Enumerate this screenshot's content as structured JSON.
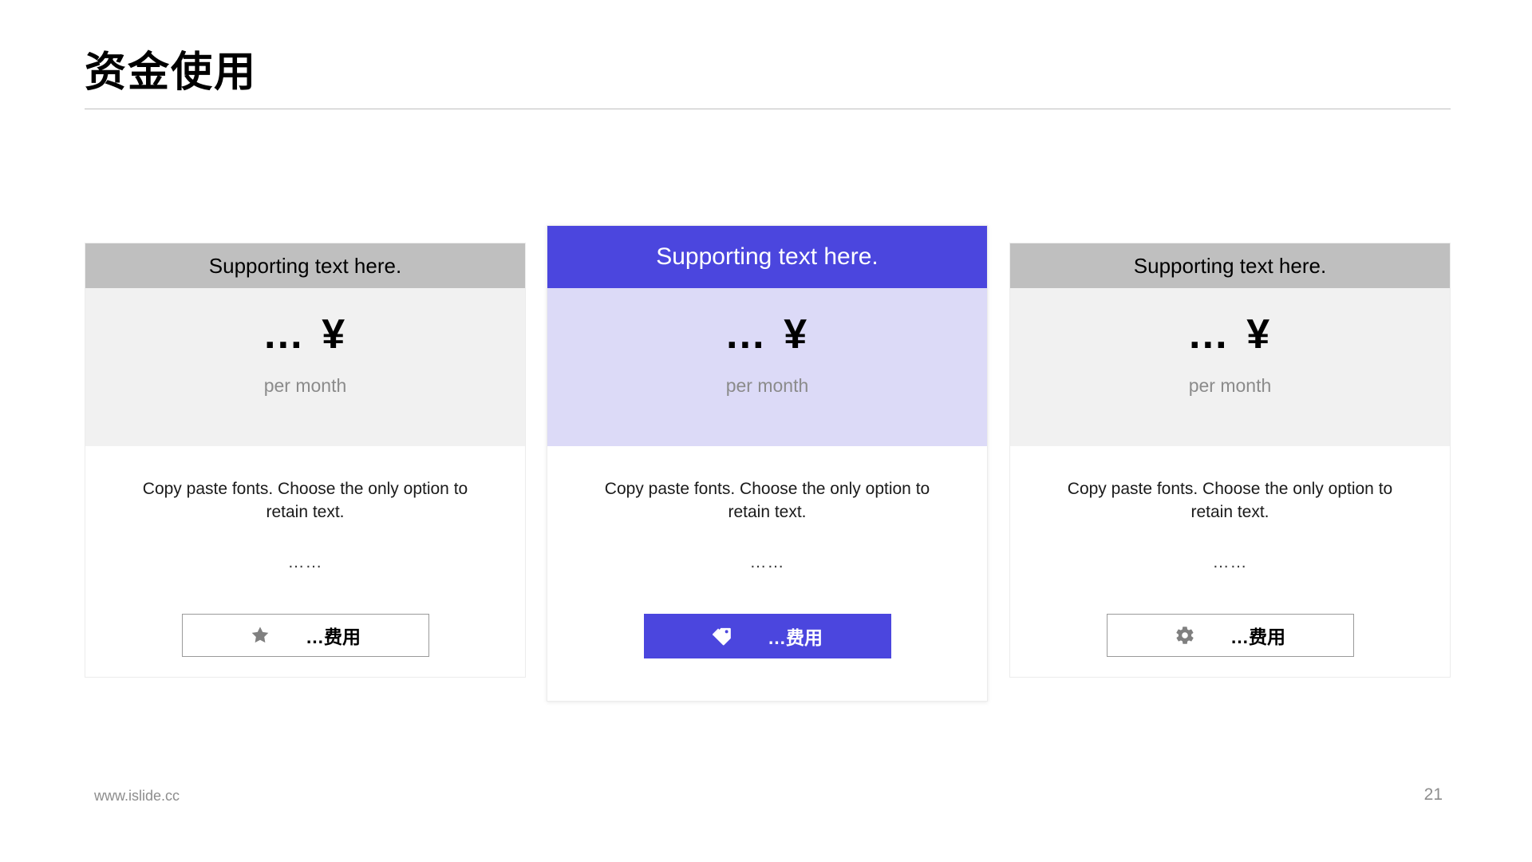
{
  "slide": {
    "title": "资金使用",
    "page_number": "21",
    "footer_url": "www.islide.cc",
    "accent_color": "#4b46de",
    "header_gray": "#bfbfbf",
    "body_gray": "#f1f1f1",
    "body_lavender": "#dcdaf7"
  },
  "cards": [
    {
      "header": "Supporting text here.",
      "price": "… ¥",
      "period": "per month",
      "description": "Copy paste fonts. Choose the only option to retain text.",
      "dots": "……",
      "cta_label": "…费用",
      "cta_icon": "star-icon",
      "featured": "false"
    },
    {
      "header": "Supporting text here.",
      "price": "… ¥",
      "period": "per month",
      "description": "Copy paste fonts. Choose the only option to retain text.",
      "dots": "……",
      "cta_label": "…费用",
      "cta_icon": "price-tag-icon",
      "featured": "true"
    },
    {
      "header": "Supporting text here.",
      "price": "… ¥",
      "period": "per month",
      "description": "Copy paste fonts. Choose the only option to retain text.",
      "dots": "……",
      "cta_label": "…费用",
      "cta_icon": "gear-icon",
      "featured": "false"
    }
  ]
}
